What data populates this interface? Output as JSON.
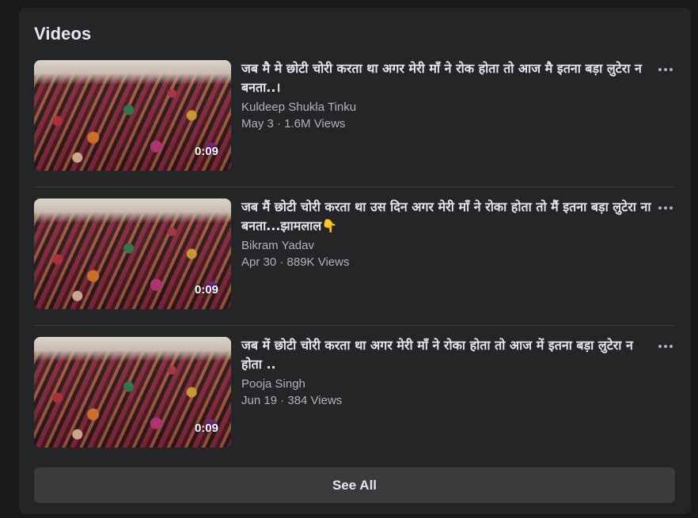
{
  "section": {
    "title": "Videos"
  },
  "videos": [
    {
      "title": "जब मै मे छोटी चोरी करता था अगर मेरी माँ ने रोक होता तो आज मै इतना बड़ा लुटेरा न बनता..।",
      "author": "Kuldeep Shukla Tinku",
      "meta": "May 3 · 1.6M Views",
      "duration": "0:09",
      "more_icon": "more-horizontal-icon"
    },
    {
      "title": "जब मैं छोटी चोरी करता था उस दिन अगर मेरी माँ ने रोका होता तो मैं इतना बड़ा लुटेरा ना बनता...झामलाल👇",
      "author": "Bikram Yadav",
      "meta": "Apr 30 · 889K Views",
      "duration": "0:09",
      "more_icon": "more-horizontal-icon"
    },
    {
      "title": "जब में छोटी चोरी करता था अगर मेरी माँ ने रोका होता तो आज में इतना बड़ा लुटेरा न होता ..",
      "author": "Pooja Singh",
      "meta": "Jun 19 · 384 Views",
      "duration": "0:09",
      "more_icon": "more-horizontal-icon"
    }
  ],
  "see_all": {
    "label": "See All"
  },
  "colors": {
    "page_bg": "#18191a",
    "card_bg": "#242526",
    "primary_text": "#e4e6eb",
    "secondary_text": "#b0b3b8",
    "button_bg": "#3a3b3c"
  }
}
